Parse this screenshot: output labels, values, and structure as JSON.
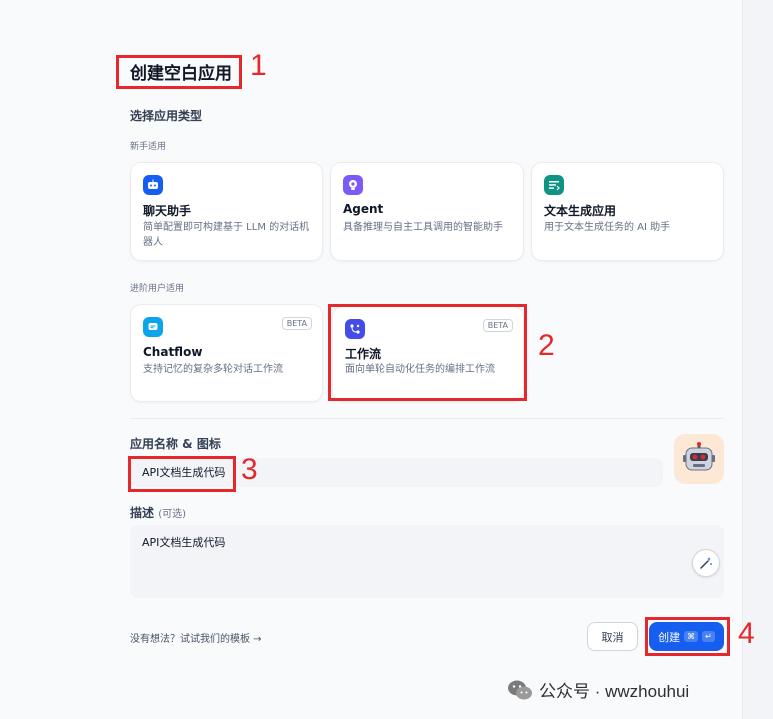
{
  "dialog": {
    "title": "创建空白应用",
    "section_type_label": "选择应用类型",
    "group_beginner_label": "新手适用",
    "group_advanced_label": "进阶用户适用",
    "beginner_cards": [
      {
        "title": "聊天助手",
        "desc": "简单配置即可构建基于 LLM 的对话机器人",
        "icon": "chat-bot-icon",
        "color": "#155eef"
      },
      {
        "title": "Agent",
        "desc": "具备推理与自主工具调用的智能助手",
        "icon": "agent-icon",
        "color": "#7a5af8"
      },
      {
        "title": "文本生成应用",
        "desc": "用于文本生成任务的 AI 助手",
        "icon": "text-generation-icon",
        "color": "#0e9384"
      }
    ],
    "advanced_cards": [
      {
        "title": "Chatflow",
        "desc": "支持记忆的复杂多轮对话工作流",
        "badge": "BETA",
        "icon": "chatflow-icon",
        "color": "#0ba5ec"
      },
      {
        "title": "工作流",
        "desc": "面向单轮自动化任务的编排工作流",
        "badge": "BETA",
        "icon": "workflow-icon",
        "color": "#444ce7"
      }
    ],
    "name_label": "应用名称 & 图标",
    "name_value": "API文档生成代码",
    "avatar_icon": "robot-emoji-icon",
    "desc_label": "描述",
    "desc_optional": "(可选)",
    "desc_value": "API文档生成代码",
    "template_link": "没有想法？试试我们的模板 →",
    "cancel_label": "取消",
    "create_label": "创建",
    "create_kbd_1": "⌘",
    "create_kbd_2": "↵"
  },
  "annotations": {
    "n1": "1",
    "n2": "2",
    "n3": "3",
    "n4": "4",
    "color": "#e4282b"
  },
  "watermark": {
    "text": "公众号 · wwzhouhui",
    "icon": "wechat-icon"
  }
}
